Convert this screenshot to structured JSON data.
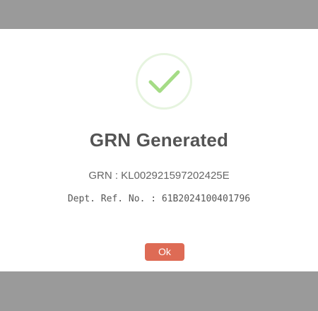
{
  "dialog": {
    "title": "GRN Generated",
    "grn_label": "GRN :",
    "grn_value": "KL002921597202425E",
    "dept_ref_label": "Dept. Ref. No. :",
    "dept_ref_value": "61B2024100401796",
    "ok_label": "Ok",
    "icon": "checkmark-success-icon"
  },
  "colors": {
    "overlay": "#9a9a9a",
    "dialog_bg": "#ffffff",
    "check": "#a5dc86",
    "ring": "#e6f4df",
    "title": "#545454",
    "ok_button": "#de6b55"
  }
}
